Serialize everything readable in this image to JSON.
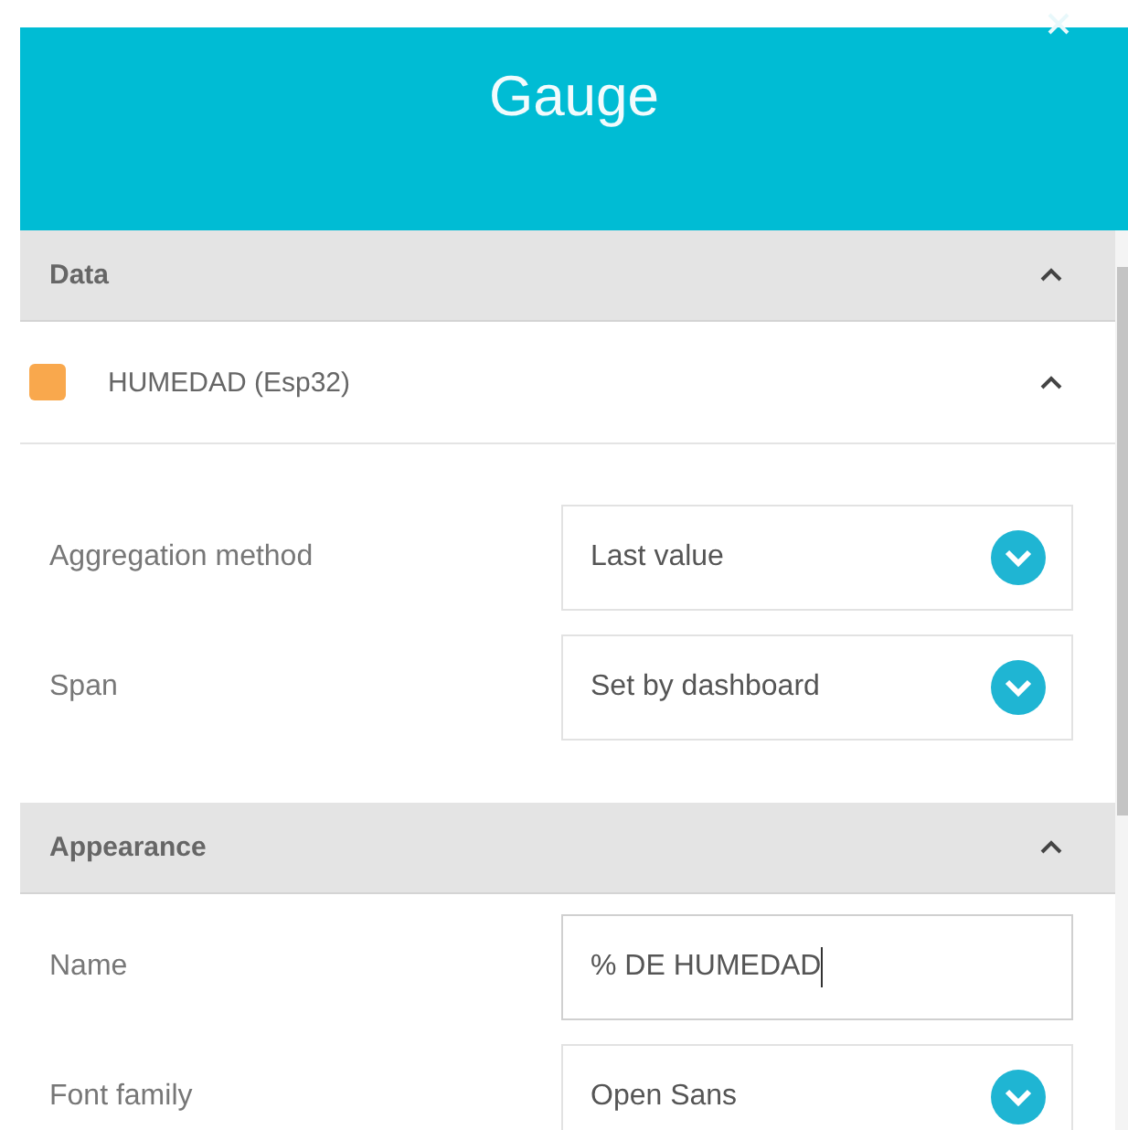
{
  "dialog": {
    "title": "Gauge"
  },
  "sections": [
    {
      "title": "Data",
      "expanded": true,
      "series": [
        {
          "name": "HUMEDAD (Esp32)",
          "color": "#f9a84d",
          "expanded": true
        }
      ],
      "fields": [
        {
          "label": "Aggregation method",
          "kind": "select",
          "value": "Last value"
        },
        {
          "label": "Span",
          "kind": "select",
          "value": "Set by dashboard"
        }
      ]
    },
    {
      "title": "Appearance",
      "expanded": true,
      "fields": [
        {
          "label": "Name",
          "kind": "text",
          "value": "% DE HUMEDAD",
          "focused": true
        },
        {
          "label": "Font family",
          "kind": "select",
          "value": "Open Sans"
        }
      ]
    }
  ]
}
